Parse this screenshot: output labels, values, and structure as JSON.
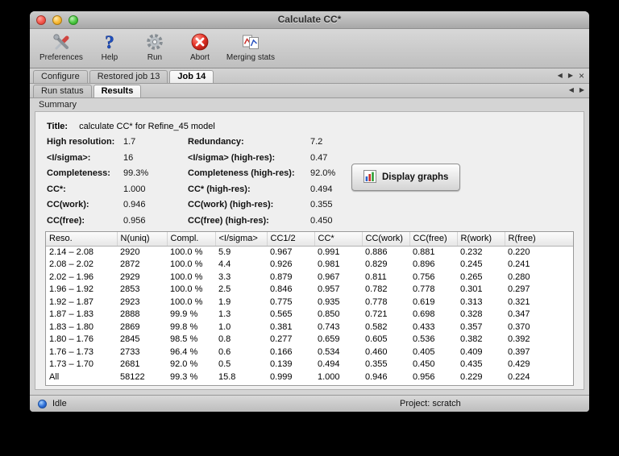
{
  "window": {
    "title": "Calculate CC*"
  },
  "toolbar": {
    "items": [
      {
        "label": "Preferences",
        "icon": "preferences-icon"
      },
      {
        "label": "Help",
        "icon": "help-icon"
      },
      {
        "label": "Run",
        "icon": "run-icon"
      },
      {
        "label": "Abort",
        "icon": "abort-icon"
      },
      {
        "label": "Merging stats",
        "icon": "merging-stats-icon"
      }
    ]
  },
  "job_tabs": {
    "tabs": [
      {
        "label": "Configure",
        "active": false
      },
      {
        "label": "Restored job 13",
        "active": false
      },
      {
        "label": "Job 14",
        "active": true
      }
    ]
  },
  "result_tabs": {
    "tabs": [
      {
        "label": "Run status",
        "active": false
      },
      {
        "label": "Results",
        "active": true
      }
    ]
  },
  "summary": {
    "section_label": "Summary",
    "title_label": "Title:",
    "title_value": "calculate CC* for Refine_45 model",
    "rows": [
      {
        "label1": "High resolution:",
        "value1": "1.7",
        "label2": "Redundancy:",
        "value2": "7.2"
      },
      {
        "label1": "<I/sigma>:",
        "value1": "16",
        "label2": "<I/sigma> (high-res):",
        "value2": "0.47"
      },
      {
        "label1": "Completeness:",
        "value1": "99.3%",
        "label2": "Completeness (high-res):",
        "value2": "92.0%"
      },
      {
        "label1": "CC*:",
        "value1": "1.000",
        "label2": "CC* (high-res):",
        "value2": "0.494"
      },
      {
        "label1": "CC(work):",
        "value1": "0.946",
        "label2": "CC(work) (high-res):",
        "value2": "0.355"
      },
      {
        "label1": "CC(free):",
        "value1": "0.956",
        "label2": "CC(free) (high-res):",
        "value2": "0.450"
      }
    ],
    "display_graphs_label": "Display graphs"
  },
  "table": {
    "columns": [
      "Reso.",
      "N(uniq)",
      "Compl.",
      "<I/sigma>",
      "CC1/2",
      "CC*",
      "CC(work)",
      "CC(free)",
      "R(work)",
      "R(free)"
    ],
    "rows": [
      [
        "2.14 – 2.08",
        "2920",
        "100.0 %",
        "5.9",
        "0.967",
        "0.991",
        "0.886",
        "0.881",
        "0.232",
        "0.220"
      ],
      [
        "2.08 – 2.02",
        "2872",
        "100.0 %",
        "4.4",
        "0.926",
        "0.981",
        "0.829",
        "0.896",
        "0.245",
        "0.241"
      ],
      [
        "2.02 – 1.96",
        "2929",
        "100.0 %",
        "3.3",
        "0.879",
        "0.967",
        "0.811",
        "0.756",
        "0.265",
        "0.280"
      ],
      [
        "1.96 – 1.92",
        "2853",
        "100.0 %",
        "2.5",
        "0.846",
        "0.957",
        "0.782",
        "0.778",
        "0.301",
        "0.297"
      ],
      [
        "1.92 – 1.87",
        "2923",
        "100.0 %",
        "1.9",
        "0.775",
        "0.935",
        "0.778",
        "0.619",
        "0.313",
        "0.321"
      ],
      [
        "1.87 – 1.83",
        "2888",
        "99.9 %",
        "1.3",
        "0.565",
        "0.850",
        "0.721",
        "0.698",
        "0.328",
        "0.347"
      ],
      [
        "1.83 – 1.80",
        "2869",
        "99.8 %",
        "1.0",
        "0.381",
        "0.743",
        "0.582",
        "0.433",
        "0.357",
        "0.370"
      ],
      [
        "1.80 – 1.76",
        "2845",
        "98.5 %",
        "0.8",
        "0.277",
        "0.659",
        "0.605",
        "0.536",
        "0.382",
        "0.392"
      ],
      [
        "1.76 – 1.73",
        "2733",
        "96.4 %",
        "0.6",
        "0.166",
        "0.534",
        "0.460",
        "0.405",
        "0.409",
        "0.397"
      ],
      [
        "1.73 – 1.70",
        "2681",
        "92.0 %",
        "0.5",
        "0.139",
        "0.494",
        "0.355",
        "0.450",
        "0.435",
        "0.429"
      ],
      [
        "All",
        "58122",
        "99.3 %",
        "15.8",
        "0.999",
        "1.000",
        "0.946",
        "0.956",
        "0.229",
        "0.224"
      ]
    ]
  },
  "statusbar": {
    "status": "Idle",
    "project": "Project: scratch"
  }
}
